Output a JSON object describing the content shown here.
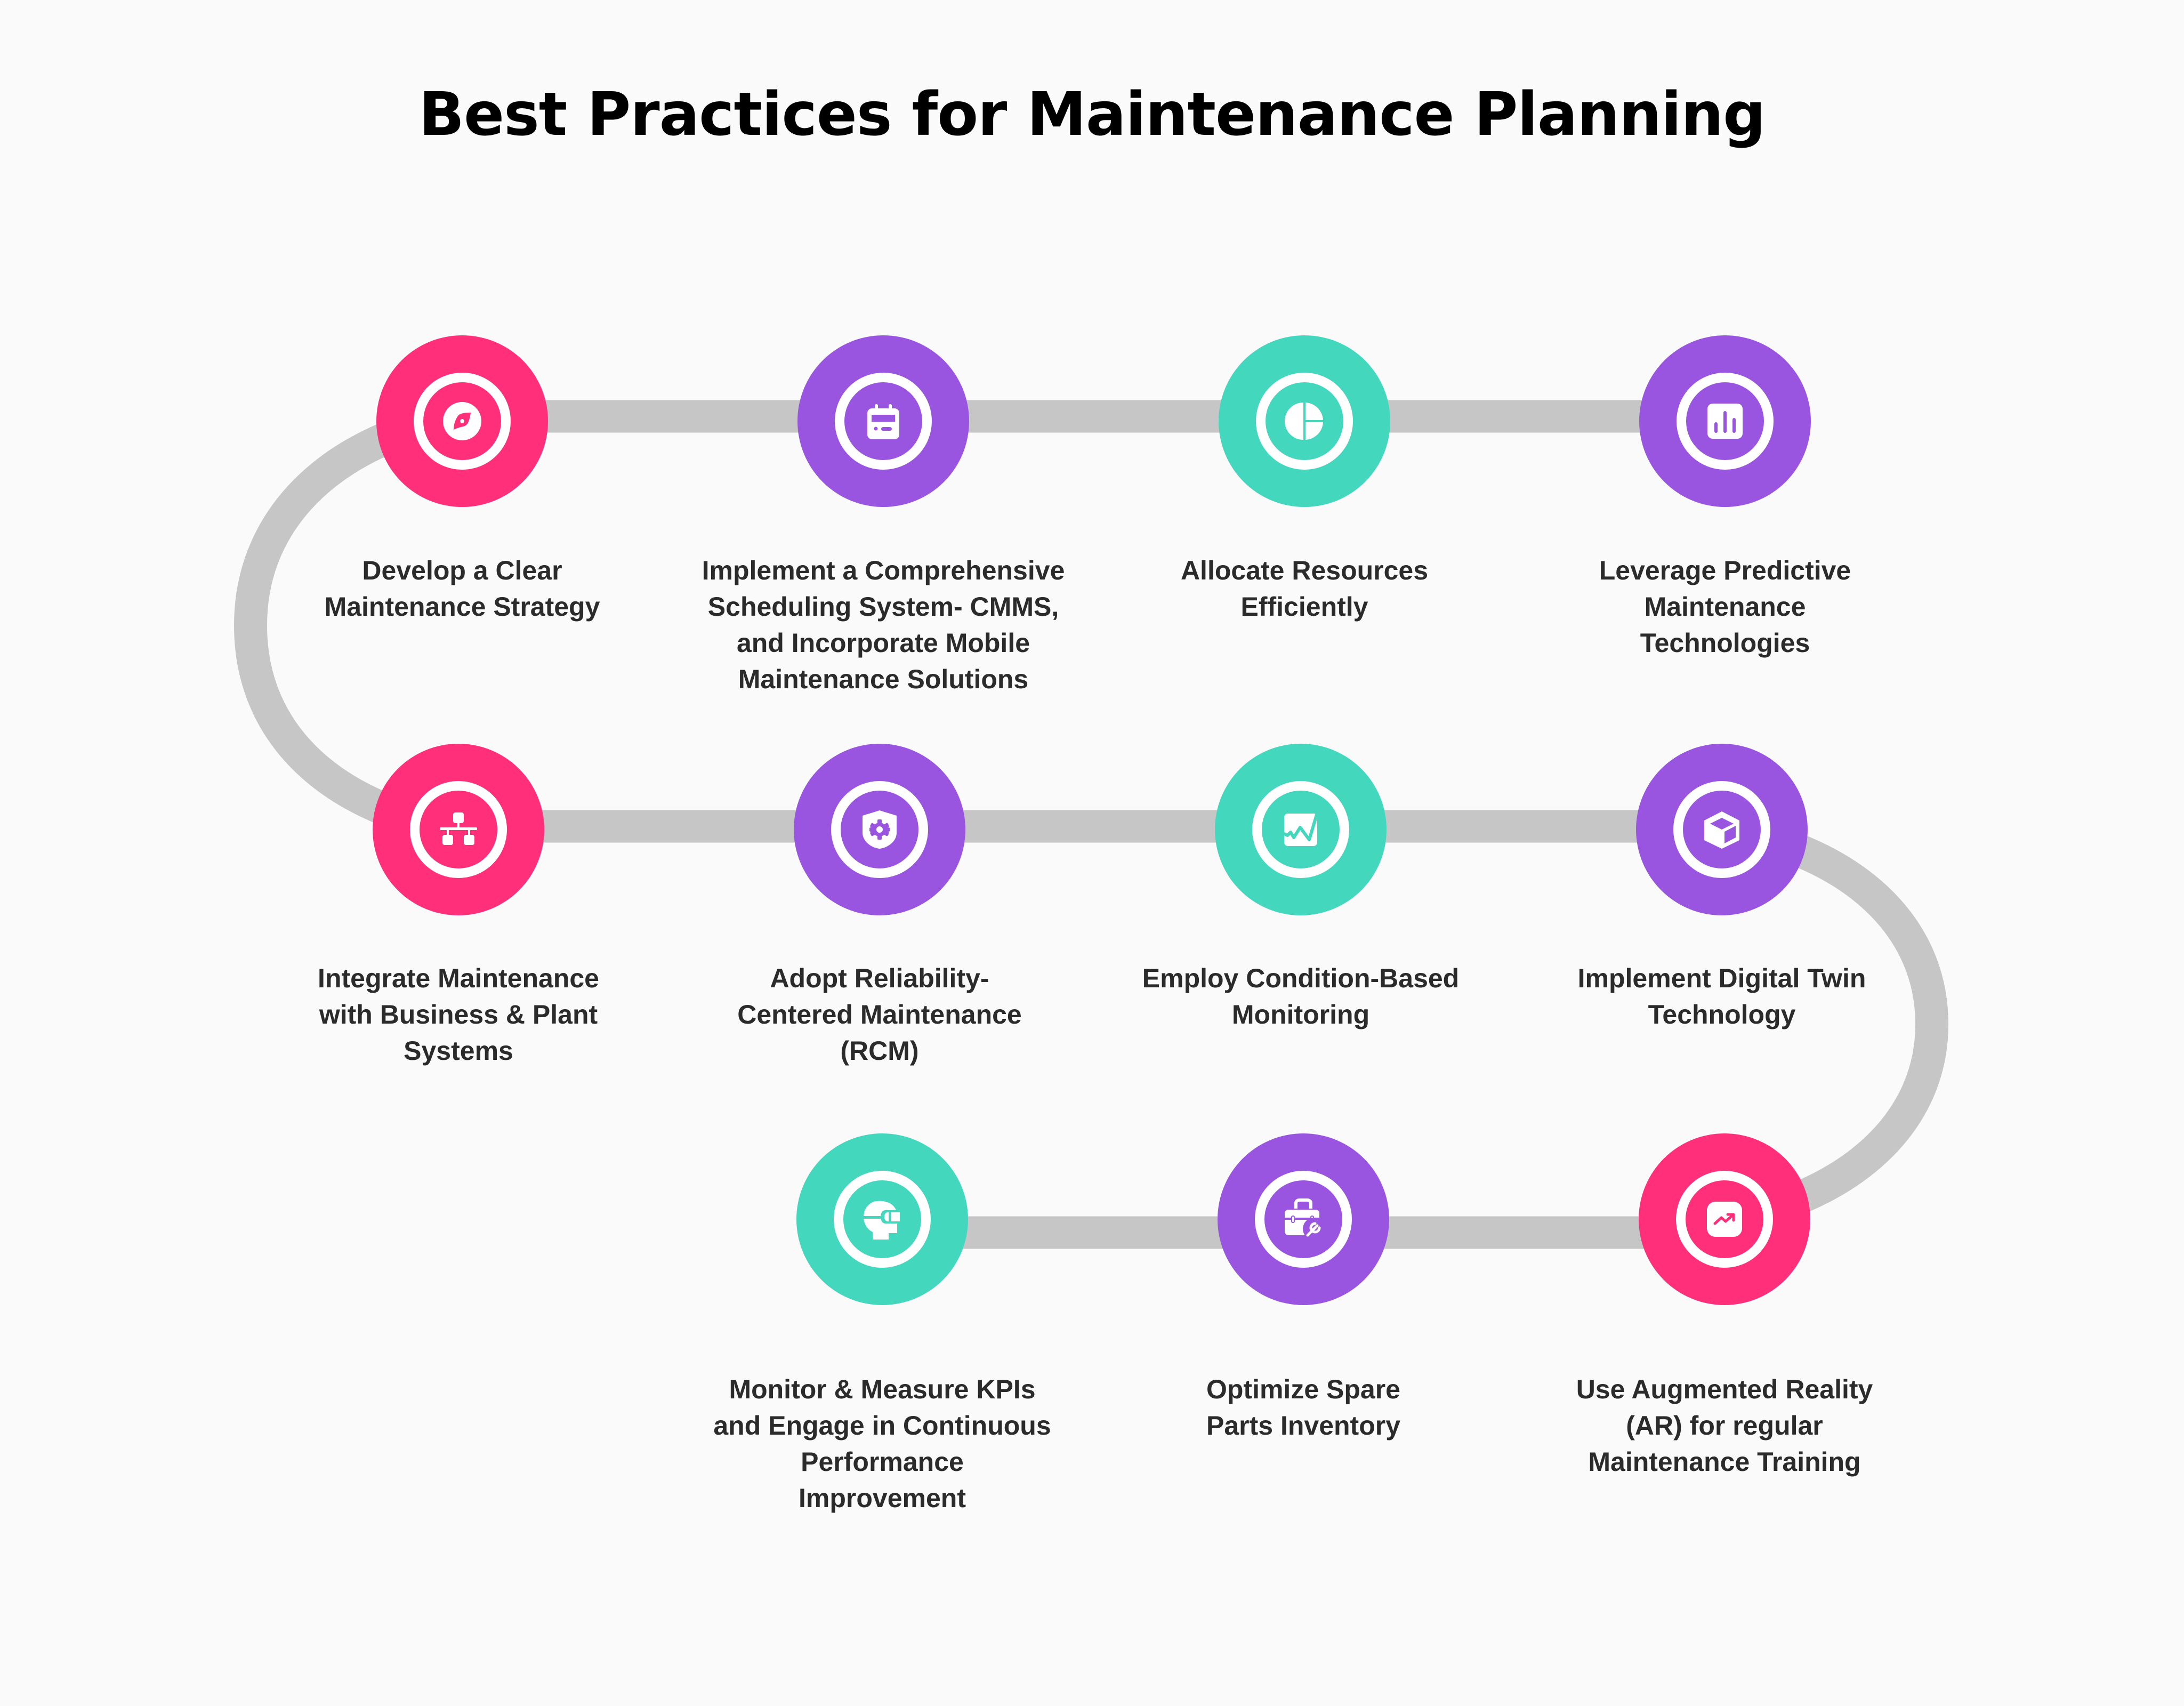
{
  "title": "Best Practices for Maintenance Planning",
  "colors": {
    "background": "#fafafa",
    "path": "#c6c6c6",
    "pink": "#ff2f7a",
    "purple": "#9a55e0",
    "teal": "#43d7bd",
    "ring": "#ffffff",
    "text": "#2b2b2b"
  },
  "steps": [
    {
      "label": "Develop a Clear\nMaintenance Strategy",
      "color": "pink",
      "icon": "compass-icon"
    },
    {
      "label": "Implement a Comprehensive\nScheduling System- CMMS,\nand Incorporate Mobile\nMaintenance Solutions",
      "color": "purple",
      "icon": "calendar-icon"
    },
    {
      "label": "Allocate Resources\nEfficiently",
      "color": "teal",
      "icon": "pie-chart-icon"
    },
    {
      "label": "Leverage Predictive\nMaintenance\nTechnologies",
      "color": "purple",
      "icon": "bar-chart-icon"
    },
    {
      "label": "Integrate Maintenance\nwith Business & Plant\nSystems",
      "color": "pink",
      "icon": "hierarchy-icon"
    },
    {
      "label": "Adopt Reliability-\nCentered Maintenance\n(RCM)",
      "color": "purple",
      "icon": "shield-gear-icon"
    },
    {
      "label": "Employ Condition-Based\nMonitoring",
      "color": "teal",
      "icon": "activity-graph-icon"
    },
    {
      "label": "Implement Digital Twin\nTechnology",
      "color": "purple",
      "icon": "cube-icon"
    },
    {
      "label": "Monitor & Measure KPIs\nand Engage in Continuous\nPerformance\nImprovement",
      "color": "teal",
      "icon": "vr-headset-icon"
    },
    {
      "label": "Optimize Spare\nParts Inventory",
      "color": "purple",
      "icon": "toolbox-icon"
    },
    {
      "label": "Use Augmented Reality\n(AR) for regular\nMaintenance Training",
      "color": "pink",
      "icon": "trend-up-icon"
    }
  ]
}
